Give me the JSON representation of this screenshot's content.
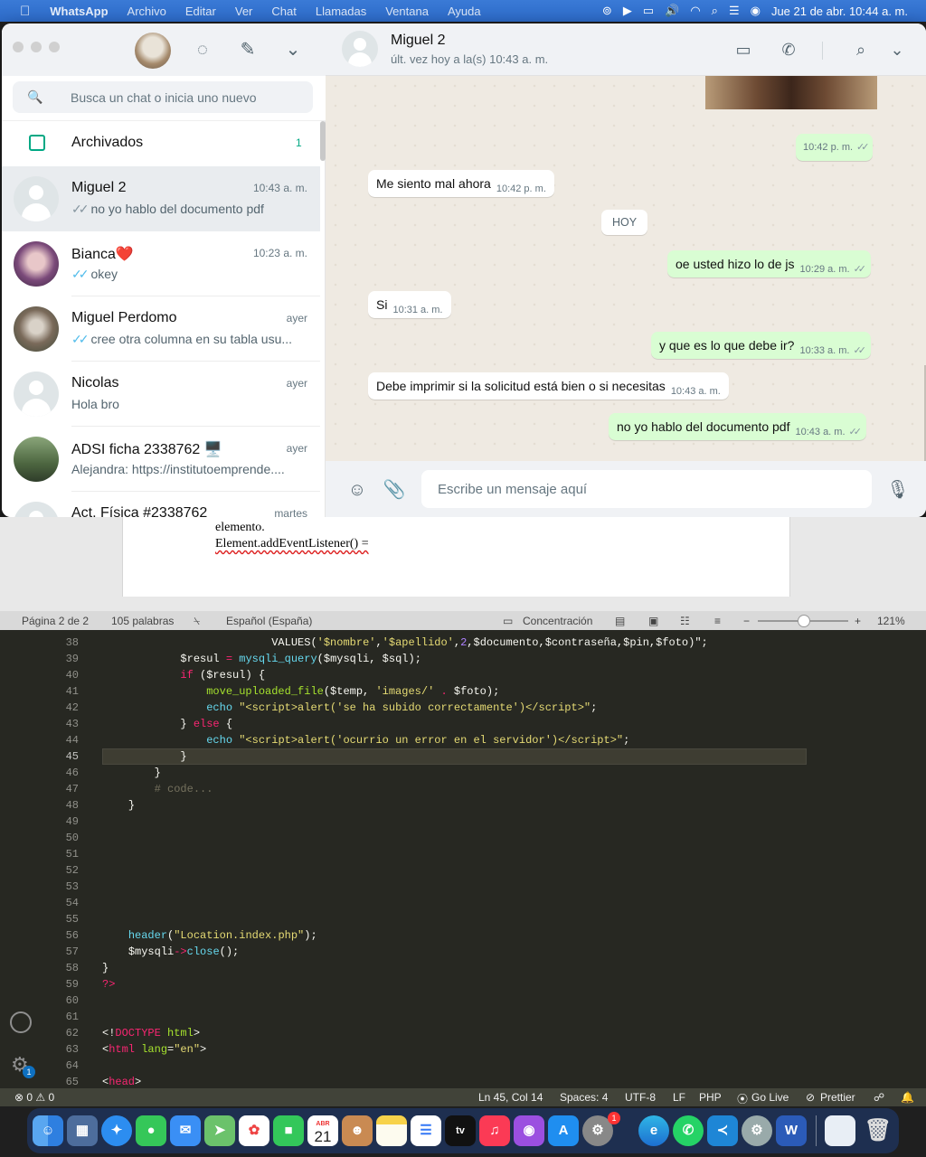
{
  "menubar": {
    "apple": "",
    "app": "WhatsApp",
    "items": [
      "Archivo",
      "Editar",
      "Ver",
      "Chat",
      "Llamadas",
      "Ventana",
      "Ayuda"
    ],
    "datetime": "Jue 21 de abr.  10:44 a. m."
  },
  "sidebar": {
    "search_placeholder": "Busca un chat o inicia uno nuevo",
    "archived_label": "Archivados",
    "archived_count": "1",
    "chats": [
      {
        "name": "Miguel 2",
        "time": "10:43 a. m.",
        "preview": "no yo hablo del documento pdf",
        "tick": "grey"
      },
      {
        "name": "Bianca❤️",
        "time": "10:23 a. m.",
        "preview": "okey",
        "tick": "blue"
      },
      {
        "name": "Miguel Perdomo",
        "time": "ayer",
        "preview": "cree otra columna en su tabla usu...",
        "tick": "blue"
      },
      {
        "name": "Nicolas",
        "time": "ayer",
        "preview": "Hola bro",
        "tick": ""
      },
      {
        "name": "ADSI ficha  2338762 🖥️",
        "time": "ayer",
        "preview": "Alejandra: https://institutoemprende....",
        "tick": ""
      },
      {
        "name": "Act. Física #2338762",
        "time": "martes",
        "preview": "",
        "tick": ""
      }
    ]
  },
  "conversation": {
    "title": "Miguel 2",
    "subtitle": "últ. vez hoy a la(s) 10:43 a. m.",
    "day_chip": "HOY",
    "messages": [
      {
        "dir": "out",
        "text": "",
        "time": "10:42 p. m."
      },
      {
        "dir": "in",
        "text": "Me siento mal ahora",
        "time": "10:42 p. m."
      },
      {
        "dir": "out",
        "text": "oe usted hizo lo de js",
        "time": "10:29 a. m."
      },
      {
        "dir": "in",
        "text": "Si",
        "time": "10:31 a. m."
      },
      {
        "dir": "out",
        "text": "y que es lo que debe ir?",
        "time": "10:33 a. m."
      },
      {
        "dir": "in",
        "text": "Debe imprimir si la solicitud está bien o si necesitas",
        "time": "10:43 a. m."
      },
      {
        "dir": "out",
        "text": "no yo hablo del documento pdf",
        "time": "10:43 a. m."
      }
    ],
    "composer_placeholder": "Escribe un mensaje aquí"
  },
  "word": {
    "line1": "elemento.",
    "line2": "Element.addEventListener() =",
    "status": {
      "page": "Página 2 de 2",
      "words": "105 palabras",
      "language": "Español (España)",
      "focus": "Concentración",
      "zoom": "121%"
    }
  },
  "vscode": {
    "current_line": 45,
    "status": {
      "problems": "⊗ 0 ⚠ 0",
      "position": "Ln 45, Col 14",
      "spaces": "Spaces: 4",
      "encoding": "UTF-8",
      "eol": "LF",
      "lang": "PHP",
      "golive": "Go Live",
      "prettier": "Prettier"
    },
    "line_numbers": [
      38,
      39,
      40,
      41,
      42,
      43,
      44,
      45,
      46,
      47,
      48,
      49,
      50,
      51,
      52,
      53,
      54,
      55,
      56,
      57,
      58,
      59,
      60,
      61,
      62,
      63,
      64,
      65
    ],
    "settings_badge": "1"
  },
  "dock": {
    "calendar_month": "ABR",
    "calendar_day": "21",
    "settings_badge": "1",
    "apps": [
      "Finder",
      "Launchpad",
      "Safari",
      "Mensajes",
      "Mail",
      "Mapas",
      "Fotos",
      "FaceTime",
      "Calendario",
      "Contactos",
      "Notas",
      "Recordatorios",
      "TV",
      "Música",
      "Podcasts",
      "App Store",
      "Preferencias del Sistema",
      "Edge",
      "WhatsApp",
      "VS Code",
      "Utilidad de Discos",
      "Word",
      "Papelera"
    ]
  }
}
